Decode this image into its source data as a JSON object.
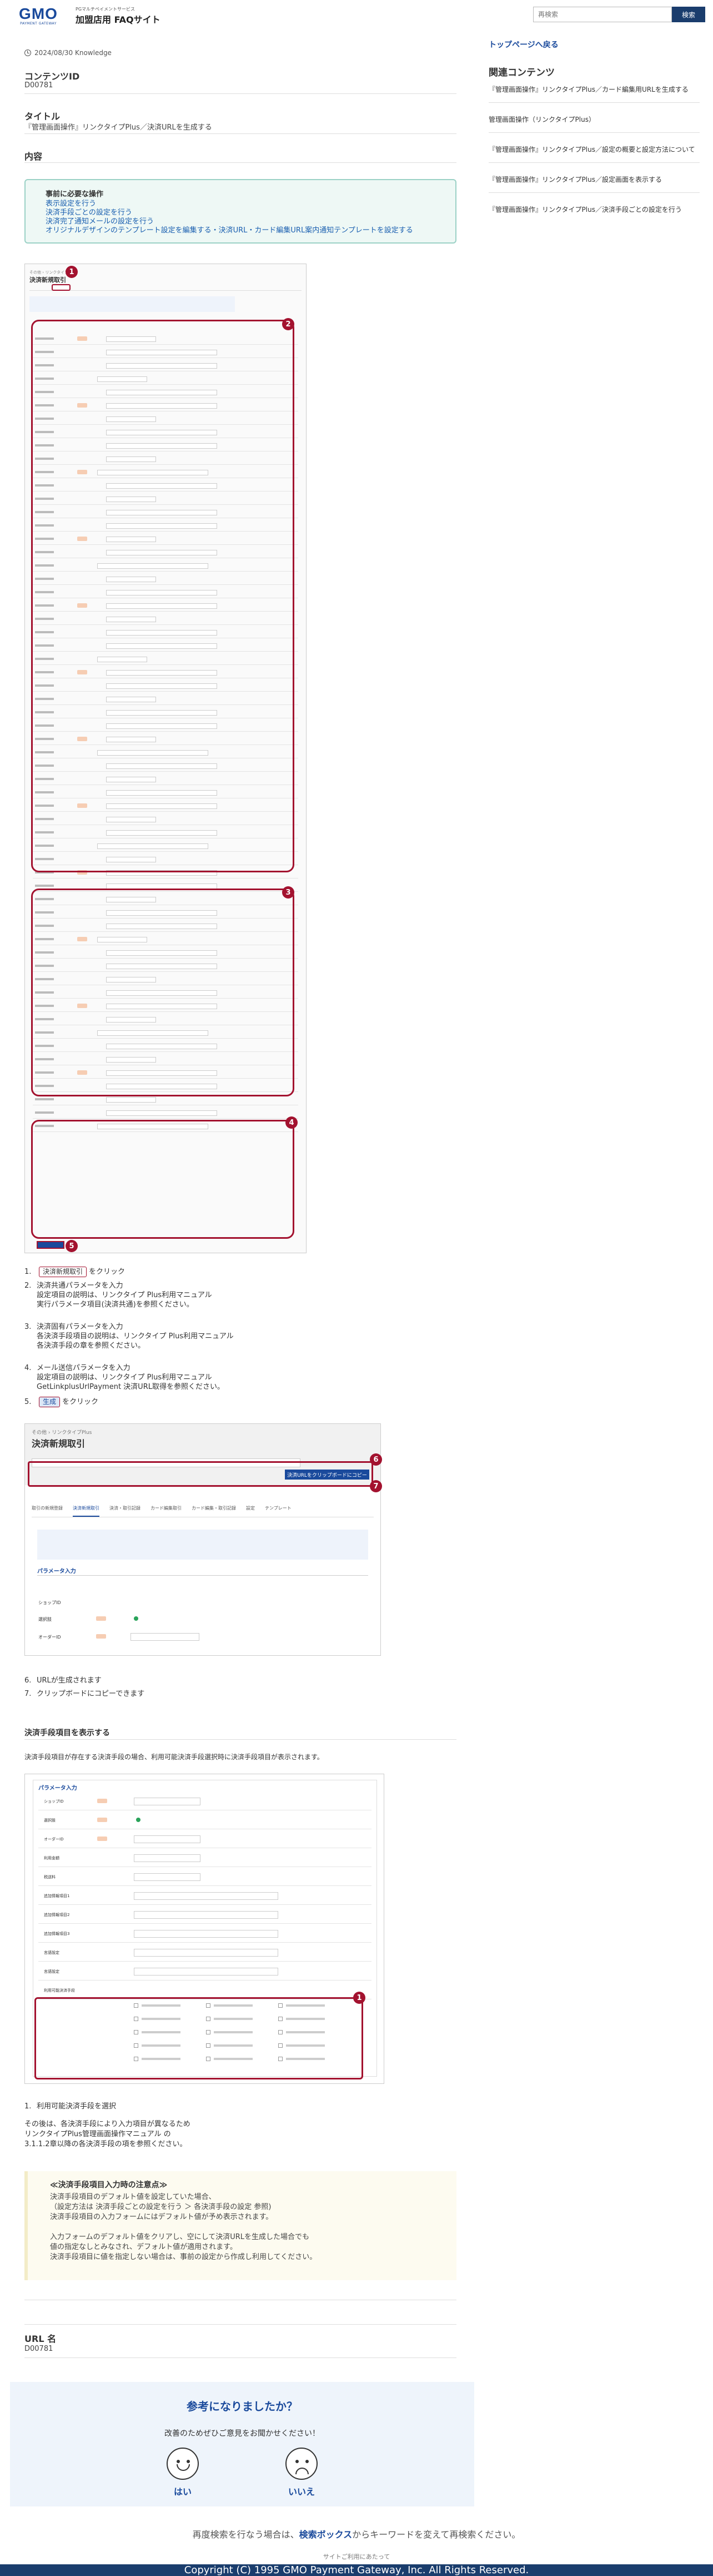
{
  "header": {
    "logo_text": "GMO",
    "logo_sub": "PAYMENT GATEWAY",
    "site_tag": "PGマルチペイメントサービス",
    "site_name": "加盟店用 FAQサイト",
    "search_placeholder": "再検索",
    "search_button": "検索"
  },
  "article": {
    "date": "2024/08/30 Knowledge",
    "content_id_label": "コンテンツID",
    "content_id": "D00781",
    "title_label": "タイトル",
    "title": "『管理画面操作』リンクタイプPlus／決済URLを生成する",
    "content_label": "内容",
    "toc_title": "事前に必要な操作",
    "toc_links": [
      "表示設定を行う",
      "決済手段ごとの設定を行う",
      "決済完了通知メールの設定を行う",
      "オリジナルデザインのテンプレート設定を編集する・決済URL・カード編集URL案内通知テンプレートを設定する"
    ]
  },
  "sidebar": {
    "top_link": "トップページへ戻る",
    "related_title": "関連コンテンツ",
    "items": [
      "『管理画面操作』リンクタイプPlus／カード編集用URLを生成する",
      "管理画面操作（リンクタイプPlus）",
      "『管理画面操作』リンクタイプPlus／設定の概要と設定方法について",
      "『管理画面操作』リンクタイプPlus／設定画面を表示する",
      "『管理画面操作』リンクタイプPlus／決済手段ごとの設定を行う"
    ]
  },
  "shot1": {
    "heading": "決済新規取引",
    "badges": [
      "1",
      "2",
      "3",
      "4",
      "5"
    ]
  },
  "steps1": [
    {
      "num": "1.",
      "lines": [
        "をクリック"
      ],
      "chip": "決済新規取引"
    },
    {
      "num": "2.",
      "lines": [
        "決済共通パラメータを入力",
        "設定項目の説明は、リンクタイプ Plus利用マニュアル",
        "実行パラメータ項目(決済共通)を参照ください。"
      ]
    },
    {
      "num": "3.",
      "lines": [
        "決済固有パラメータを入力",
        "各決済手段項目の説明は、リンクタイプ Plus利用マニュアル",
        "各決済手段の章を参照ください。"
      ]
    },
    {
      "num": "4.",
      "lines": [
        "メール送信パラメータを入力",
        "設定項目の説明は、リンクタイプ Plus利用マニュアル",
        "GetLinkplusUrlPayment 決済URL取得を参照ください。"
      ]
    },
    {
      "num": "5.",
      "lines": [
        "をクリック"
      ],
      "chip": "生成"
    }
  ],
  "shot2": {
    "breadcrumb": "その他 › リンクタイプPlus",
    "heading": "決済新規取引",
    "copy_button": "決済URLをクリップボードにコピー",
    "tabs": [
      "取引の新規登録",
      "決済新規取引",
      "決済・取引記録",
      "カード編集取引",
      "カード編集・取引記録",
      "設定",
      "テンプレート"
    ],
    "badges": [
      "6",
      "7"
    ],
    "section": "パラメータ入力",
    "rows": [
      "ショップID",
      "選択肢",
      "オーダーID"
    ]
  },
  "steps2": [
    {
      "num": "6.",
      "text": "URLが生成されます"
    },
    {
      "num": "7.",
      "text": "クリップボードにコピーできます"
    }
  ],
  "section2": {
    "title": "決済手段項目を表示する",
    "desc": "決済手段項目が存在する決済手段の場合、利用可能決済手段選択時に決済手段項目が表示されます。"
  },
  "shot3": {
    "section": "パラメータ入力",
    "rows": [
      "ショップID",
      "選択肢",
      "オーダーID",
      "利用金額",
      "税送料",
      "追加情報項目1",
      "追加情報項目2",
      "追加情報項目3",
      "言語設定",
      "言語設定",
      "利用可能決済手段"
    ],
    "badge": "1"
  },
  "steps3": [
    {
      "num": "1.",
      "text": "利用可能決済手段を選択"
    }
  ],
  "after_steps3": [
    "その後は、各決済手段により入力項目が異なるため",
    "リンクタイプPlus管理画面操作マニュアル の",
    "3.1.1.2章以降の各決済手段の項を参照ください。"
  ],
  "note": {
    "title": "≪決済手段項目入力時の注意点≫",
    "lines": [
      "決済手段項目のデフォルト値を設定していた場合、",
      "（設定方法は 決済手段ごとの設定を行う ＞ 各決済手段の設定 参照)",
      "決済手段項目の入力フォームにはデフォルト値が予め表示されます。",
      "",
      "入力フォームのデフォルト値をクリアし、空にして決済URLを生成した場合でも",
      "値の指定なしとみなされ、デフォルト値が適用されます。",
      "決済手段項目に値を指定しない場合は、事前の設定から作成し利用してください。"
    ]
  },
  "url": {
    "label": "URL 名",
    "value": "D00781"
  },
  "feedback": {
    "title": "参考になりましたか？",
    "subtitle": "改善のためぜひご意見をお聞かせください！",
    "yes": "はい",
    "no": "いいえ"
  },
  "retry": {
    "prefix": "再度検索を行なう場合は、",
    "bold": "検索ボックス",
    "suffix": "からキーワードを変えて再検索ください。"
  },
  "footer": {
    "note": "サイトご利用にあたって",
    "copyright": "Copyright (C) 1995 GMO Payment Gateway, Inc. All Rights Reserved."
  },
  "colors": {
    "brand": "#1a4a9c",
    "accent_red": "#a3122f",
    "footer_bg": "#1a3d6d"
  }
}
